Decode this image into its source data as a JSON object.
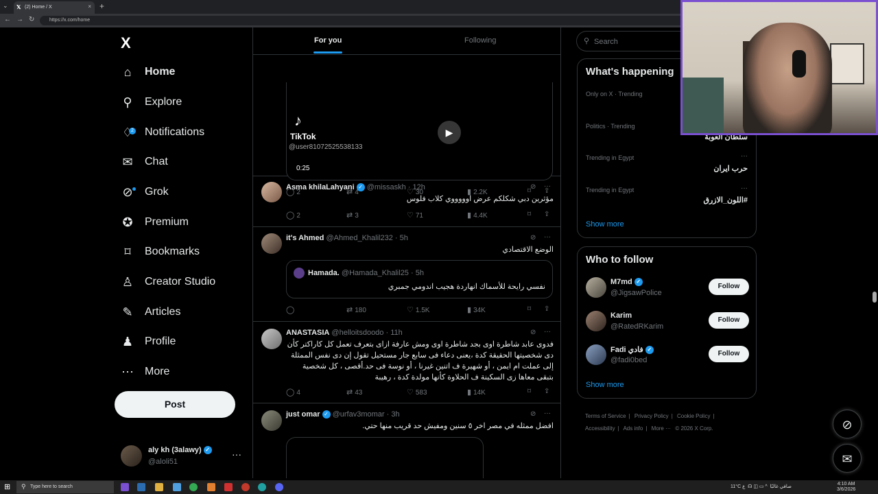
{
  "browser": {
    "tab_title": "(2) Home / X",
    "url": "https://x.com/home"
  },
  "nav": {
    "logo": "X",
    "items": [
      {
        "label": "Home",
        "icon": "home-icon",
        "glyph": "⌂"
      },
      {
        "label": "Explore",
        "icon": "search-icon",
        "glyph": "⚲"
      },
      {
        "label": "Notifications",
        "icon": "bell-icon",
        "glyph": "🔔",
        "badge": "2"
      },
      {
        "label": "Chat",
        "icon": "mail-icon",
        "glyph": "✉"
      },
      {
        "label": "Grok",
        "icon": "grok-icon",
        "glyph": "⊘"
      },
      {
        "label": "Premium",
        "icon": "premium-icon",
        "glyph": "✪"
      },
      {
        "label": "Bookmarks",
        "icon": "bookmark-icon",
        "glyph": "🔖"
      },
      {
        "label": "Creator Studio",
        "icon": "creator-studio-icon",
        "glyph": "♙"
      },
      {
        "label": "Articles",
        "icon": "articles-icon",
        "glyph": "✎"
      },
      {
        "label": "Profile",
        "icon": "profile-icon",
        "glyph": "♟"
      },
      {
        "label": "More",
        "icon": "more-circle-icon",
        "glyph": "⋯"
      }
    ],
    "post_label": "Post",
    "account": {
      "name": "aly kh (3alawy)",
      "handle": "@aloli51"
    }
  },
  "feed": {
    "tabs": [
      "For you",
      "Following"
    ],
    "video": {
      "brand": "TikTok",
      "user": "@user81072525538133",
      "time": "0:25"
    },
    "video_stats": {
      "replies": "2",
      "reposts": "4",
      "likes": "30",
      "views": "2.2K"
    },
    "tweets": [
      {
        "name": "Asma khilaLahyani",
        "handle": "@missaskh",
        "time": "12h",
        "text": "مؤثرين دبي شكلكم عرض اوووووي كلاب فلوس",
        "replies": "2",
        "reposts": "3",
        "likes": "71",
        "views": "4.4K"
      },
      {
        "name": "it's Ahmed",
        "handle": "@Ahmed_Khalil232",
        "time": "5h",
        "text": "الوضع الاقتصادي",
        "quote": {
          "name": "Hamada.",
          "handle": "@Hamada_Khalil25",
          "time": "5h",
          "text": "نفسي رايحة للأسماك انهاردة هجيب اندومي جمبري"
        },
        "replies": "",
        "reposts": "180",
        "likes": "1.5K",
        "views": "34K"
      },
      {
        "name": "ANASTASIA",
        "handle": "@helloitsdoodo",
        "time": "11h",
        "text": "فدوى عابد شاطرة اوى بجد شاطرة اوى ومش عارفة ازاى بتعرف تعمل كل كاراكتر كأن دى شخصيتها الحقيقة كدة ،يعنى دعاء فى سابع جار مستحيل تقول إن دى نفس الممثلة إلى عملت ام ايمن ، أو شهيرة ف اتنين غيرنا ، أو نوسة فى حد.أقصى ، كل شخصية بتبقى معاها زى السكينة ف الحلاوة كأنها مولدة كدة ، رهيبة",
        "replies": "4",
        "reposts": "43",
        "likes": "583",
        "views": "14K"
      },
      {
        "name": "just omar",
        "handle": "@urfav3momar",
        "time": "3h",
        "text": "افضل ممثله في مصر اخر ٥ سنين ومفيش حد قريب منها حتي."
      }
    ]
  },
  "right": {
    "search_placeholder": "Search",
    "trending": {
      "title": "What's happening",
      "items": [
        {
          "context": "Only on X · Trending",
          "name": ""
        },
        {
          "context": "Politics · Trending",
          "name": "سلطان العوبة"
        },
        {
          "context": "Trending in Egypt",
          "name": "حرب ايران"
        },
        {
          "context": "Trending in Egypt",
          "name": "#اللون_الازرق"
        }
      ],
      "show_more": "Show more"
    },
    "who_to_follow": {
      "title": "Who to follow",
      "users": [
        {
          "name": "M7md",
          "handle": "@JigsawPolice",
          "verified": true
        },
        {
          "name": "Karim",
          "handle": "@RatedRKarim",
          "verified": false
        },
        {
          "name": "Fadi فادي",
          "handle": "@fadi0bed",
          "verified": true
        }
      ],
      "follow_label": "Follow",
      "show_more": "Show more"
    },
    "footer": [
      "Terms of Service",
      "Privacy Policy",
      "Cookie Policy",
      "Accessibility",
      "Ads info",
      "More ···",
      "© 2026 X Corp."
    ]
  },
  "taskbar": {
    "search_placeholder": "Type here to search",
    "weather": "11°C",
    "weather_text": "صافي غالبًا",
    "lang": "ع",
    "time": "4:10 AM",
    "date": "3/6/2026"
  },
  "colors": {
    "accent": "#1d9bf0",
    "background": "#000000",
    "border": "#2f3336",
    "muted": "#71767b",
    "webcam_frame": "#7a4fd0"
  }
}
